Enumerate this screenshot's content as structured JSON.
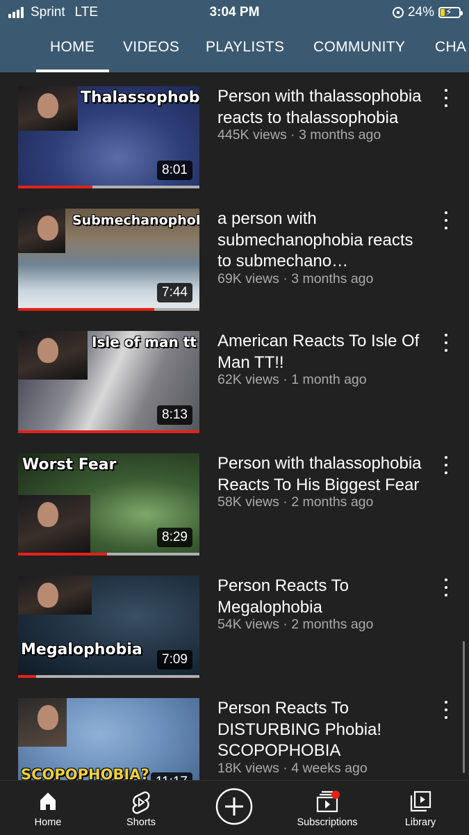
{
  "status_bar": {
    "carrier": "Sprint",
    "network": "LTE",
    "time": "3:04 PM",
    "battery": "24%",
    "battery_level": 0.24
  },
  "tabs": [
    {
      "label": "HOME",
      "selected": true
    },
    {
      "label": "VIDEOS",
      "selected": false
    },
    {
      "label": "PLAYLISTS",
      "selected": false
    },
    {
      "label": "COMMUNITY",
      "selected": false
    },
    {
      "label": "CHA",
      "selected": false
    }
  ],
  "videos": [
    {
      "title": "Person with thalassophobia reacts to thalassophobia",
      "stats": "445K views · 3 months ago",
      "duration": "8:01",
      "thumb_text": "Thalassophobia",
      "watched": 0.41
    },
    {
      "title": "a person with submechanophobia reacts to submechano…",
      "stats": "69K views · 3 months ago",
      "duration": "7:44",
      "thumb_text": "Submechanophobia",
      "watched": 0.75
    },
    {
      "title": "American Reacts To Isle Of Man TT!!",
      "stats": "62K views · 1 month ago",
      "duration": "8:13",
      "thumb_text": "Isle of man tt",
      "watched": 1.0
    },
    {
      "title": "Person with thalassophobia Reacts To His Biggest Fear",
      "stats": "58K views · 2 months ago",
      "duration": "8:29",
      "thumb_text": "Worst Fear",
      "watched": 0.49
    },
    {
      "title": "Person Reacts To Megalophobia",
      "stats": "54K views · 2 months ago",
      "duration": "7:09",
      "thumb_text": "Megalophobia",
      "watched": 0.1
    },
    {
      "title": "Person Reacts To DISTURBING Phobia! SCOPOPHOBIA",
      "stats": "18K views · 4 weeks ago",
      "duration": "11:17",
      "thumb_text": "SCOPOPHOBIA?",
      "watched": 0
    }
  ],
  "bottom_nav": [
    {
      "label": "Home",
      "icon": "home-icon"
    },
    {
      "label": "Shorts",
      "icon": "shorts-icon"
    },
    {
      "label": "",
      "icon": "create-icon"
    },
    {
      "label": "Subscriptions",
      "icon": "subscriptions-icon"
    },
    {
      "label": "Library",
      "icon": "library-icon"
    }
  ],
  "colors": {
    "header_bg": "#3b5a72",
    "background": "#212121",
    "progress": "#e62117",
    "notification_dot": "#e62117"
  }
}
